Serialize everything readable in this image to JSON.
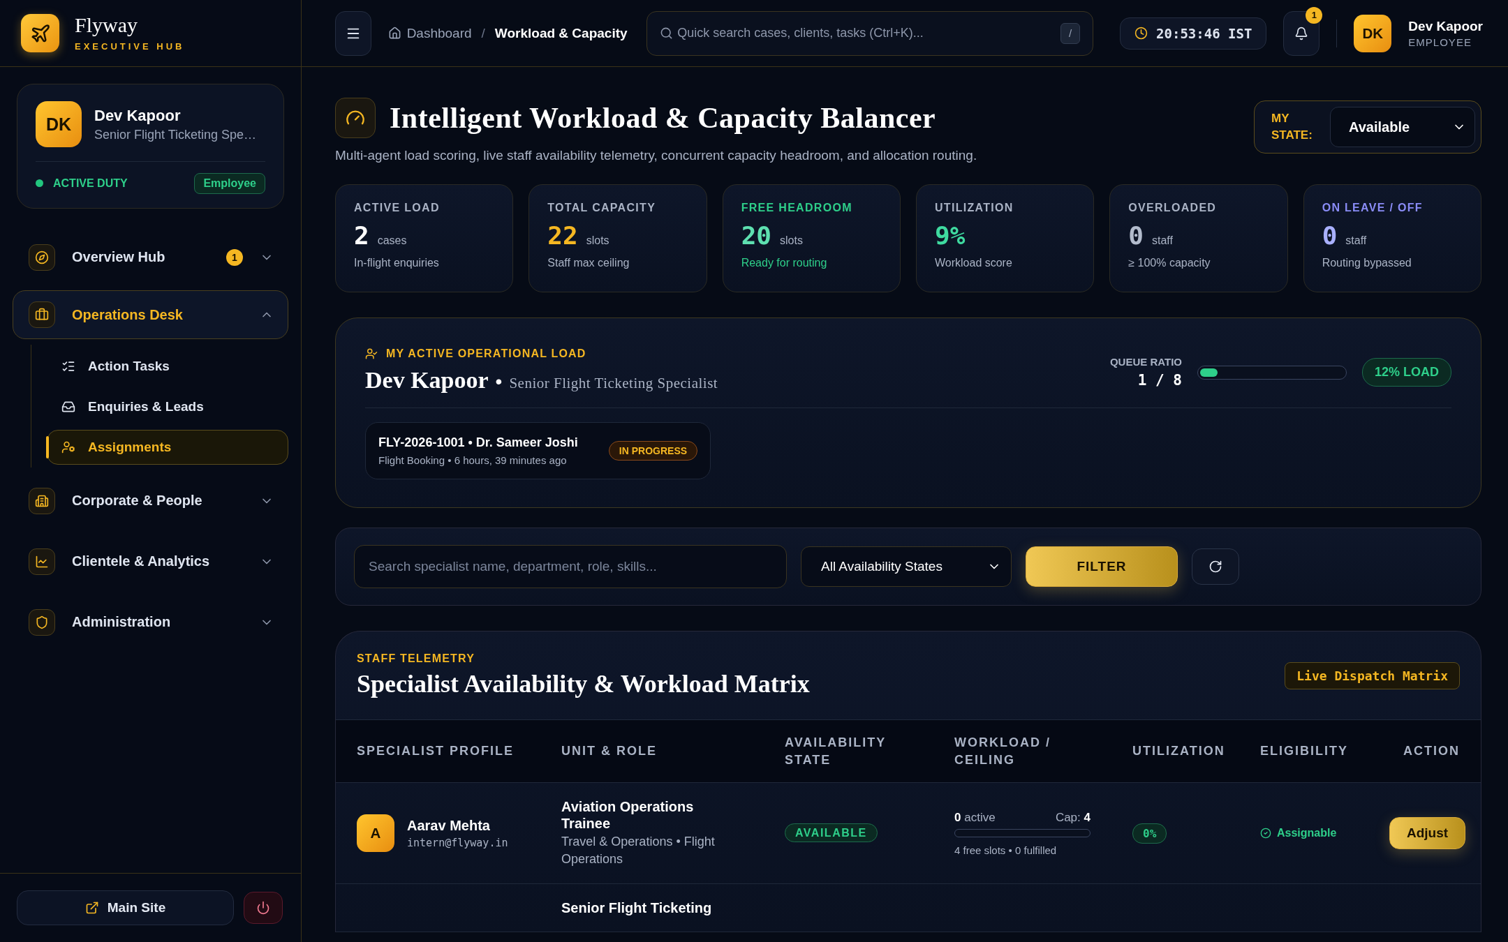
{
  "brand": {
    "name": "Flyway",
    "subtitle": "EXECUTIVE HUB"
  },
  "profile": {
    "initials": "DK",
    "name": "Dev Kapoor",
    "role": "Senior Flight Ticketing Spe…",
    "status": "ACTIVE DUTY",
    "badge": "Employee"
  },
  "nav": [
    {
      "label": "Overview Hub",
      "badge": "1",
      "expanded": false,
      "selected": false
    },
    {
      "label": "Operations Desk",
      "expanded": true,
      "selected": true,
      "children": [
        {
          "label": "Action Tasks",
          "selected": false
        },
        {
          "label": "Enquiries & Leads",
          "selected": false
        },
        {
          "label": "Assignments",
          "selected": true
        }
      ]
    },
    {
      "label": "Corporate & People",
      "expanded": false,
      "selected": false
    },
    {
      "label": "Clientele & Analytics",
      "expanded": false,
      "selected": false
    },
    {
      "label": "Administration",
      "expanded": false,
      "selected": false
    }
  ],
  "sidebar_footer": {
    "main_site": "Main Site"
  },
  "header": {
    "breadcrumb": [
      "Dashboard",
      "Workload & Capacity"
    ],
    "breadcrumb_separator": "/",
    "search_placeholder": "Quick search cases, clients, tasks (Ctrl+K)...",
    "shortcut": "/",
    "clock": "20:53:46 IST",
    "notifications": "1",
    "user": {
      "initials": "DK",
      "name": "Dev Kapoor",
      "role": "EMPLOYEE"
    }
  },
  "page": {
    "title": "Intelligent Workload & Capacity Balancer",
    "subtitle": "Multi-agent load scoring, live staff availability telemetry, concurrent capacity headroom, and allocation routing.",
    "state_label": "MY STATE:",
    "state_value": "Available"
  },
  "stats": [
    {
      "label": "ACTIVE LOAD",
      "value": "2",
      "unit": "cases",
      "note": "In-flight enquiries"
    },
    {
      "label": "TOTAL CAPACITY",
      "value": "22",
      "unit": "slots",
      "note": "Staff max ceiling"
    },
    {
      "label": "FREE HEADROOM",
      "value": "20",
      "unit": "slots",
      "note": "Ready for routing"
    },
    {
      "label": "UTILIZATION",
      "value": "9%",
      "note": "Workload score"
    },
    {
      "label": "OVERLOADED",
      "value": "0",
      "unit": "staff",
      "note": "≥ 100% capacity"
    },
    {
      "label": "ON LEAVE / OFF",
      "value": "0",
      "unit": "staff",
      "note": "Routing bypassed"
    }
  ],
  "my_load": {
    "section": "MY ACTIVE OPERATIONAL LOAD",
    "name": "Dev Kapoor",
    "separator": "•",
    "role": "Senior Flight Ticketing Specialist",
    "queue_label": "QUEUE RATIO",
    "queue": "1 / 8",
    "level": 0.12,
    "load_badge": "12% LOAD",
    "cases": [
      {
        "title": "FLY-2026-1001 • Dr. Sameer Joshi",
        "meta": "Flight Booking • 6 hours, 39 minutes ago",
        "status": "IN PROGRESS"
      }
    ]
  },
  "filters": {
    "search_placeholder": "Search specialist name, department, role, skills...",
    "select": "All Availability States",
    "filter_button": "FILTER"
  },
  "matrix": {
    "eyebrow": "STAFF TELEMETRY",
    "title": "Specialist Availability & Workload Matrix",
    "tag": "Live Dispatch Matrix",
    "columns": [
      "SPECIALIST PROFILE",
      "UNIT & ROLE",
      "AVAILABILITY STATE",
      "WORKLOAD / CEILING",
      "UTILIZATION",
      "ELIGIBILITY",
      "ACTION"
    ],
    "rows": [
      {
        "initial": "A",
        "name": "Aarav Mehta",
        "email": "intern@flyway.in",
        "role": "Aviation Operations Trainee",
        "unit": "Travel & Operations • Flight Operations",
        "availability": "AVAILABLE",
        "active": "0",
        "active_label": "active",
        "cap_label": "Cap:",
        "cap": "4",
        "level": 0,
        "slots": "4 free slots • 0 fulfilled",
        "utilization": "0%",
        "eligibility": "Assignable",
        "action": "Adjust"
      },
      {
        "role": "Senior Flight Ticketing"
      }
    ]
  }
}
